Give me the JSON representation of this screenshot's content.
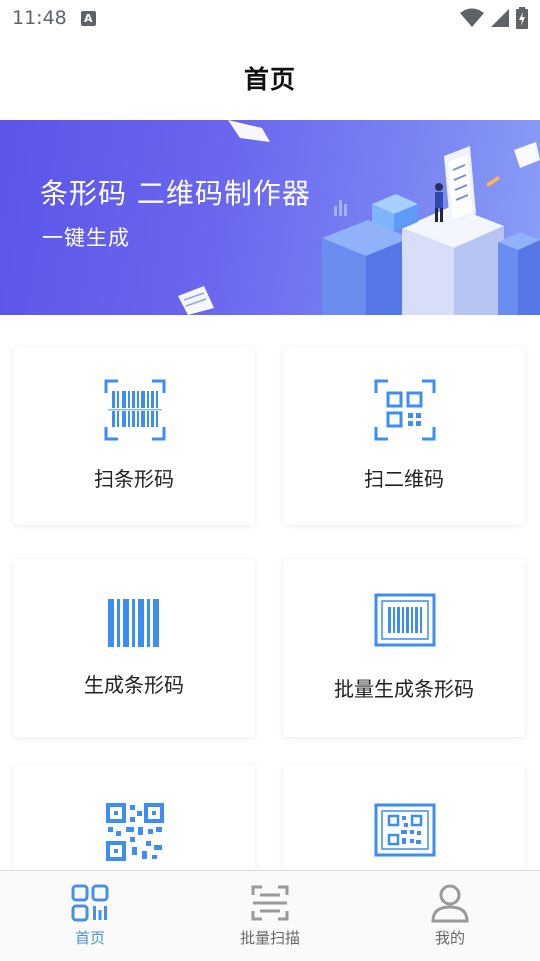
{
  "status_bar": {
    "time": "11:48",
    "notification_glyph": "A"
  },
  "header": {
    "title": "首页"
  },
  "banner": {
    "title": "条形码 二维码制作器",
    "subtitle": "一键生成"
  },
  "cards": [
    {
      "label": "扫条形码",
      "icon": "barcode-scan-icon"
    },
    {
      "label": "扫二维码",
      "icon": "qr-scan-icon"
    },
    {
      "label": "生成条形码",
      "icon": "barcode-icon"
    },
    {
      "label": "批量生成条形码",
      "icon": "batch-barcode-icon"
    },
    {
      "label": "",
      "icon": "qr-generate-icon"
    },
    {
      "label": "",
      "icon": "batch-qr-icon"
    }
  ],
  "tabs": [
    {
      "label": "首页",
      "icon": "home-qr-icon",
      "active": true
    },
    {
      "label": "批量扫描",
      "icon": "batch-scan-icon",
      "active": false
    },
    {
      "label": "我的",
      "icon": "profile-icon",
      "active": false
    }
  ],
  "colors": {
    "accent": "#4a90e2",
    "banner_start": "#5b55ea",
    "banner_end": "#8aa0f6",
    "icon_blue": "#3d8ef0"
  }
}
